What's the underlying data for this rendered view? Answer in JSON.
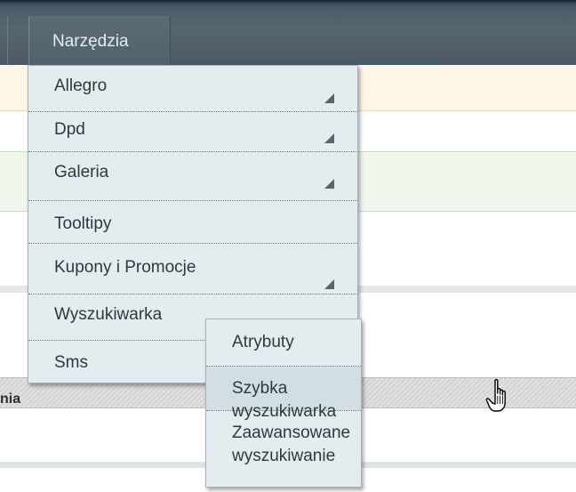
{
  "nav": {
    "tab_label": "Narzędzia"
  },
  "page": {
    "section_label": "nia"
  },
  "menu": {
    "items": [
      {
        "label": "Allegro",
        "has_submenu": true
      },
      {
        "label": "Dpd",
        "has_submenu": true
      },
      {
        "label": "Galeria",
        "has_submenu": true
      },
      {
        "label": "Tooltipy",
        "has_submenu": false
      },
      {
        "label": "Kupony i Promocje",
        "has_submenu": true
      },
      {
        "label": "Wyszukiwarka",
        "has_submenu": true
      },
      {
        "label": "Sms",
        "has_submenu": false
      }
    ],
    "submenu": {
      "items": [
        {
          "label": "Atrybuty"
        },
        {
          "label": "Szybka wyszukiwarka"
        },
        {
          "label": "Zaawansowane",
          "label2": "wyszukiwanie"
        }
      ]
    }
  },
  "colors": {
    "nav_bar": "#56666f",
    "menu_bg": "#e4ecf0",
    "menu_text": "#2c3940"
  }
}
